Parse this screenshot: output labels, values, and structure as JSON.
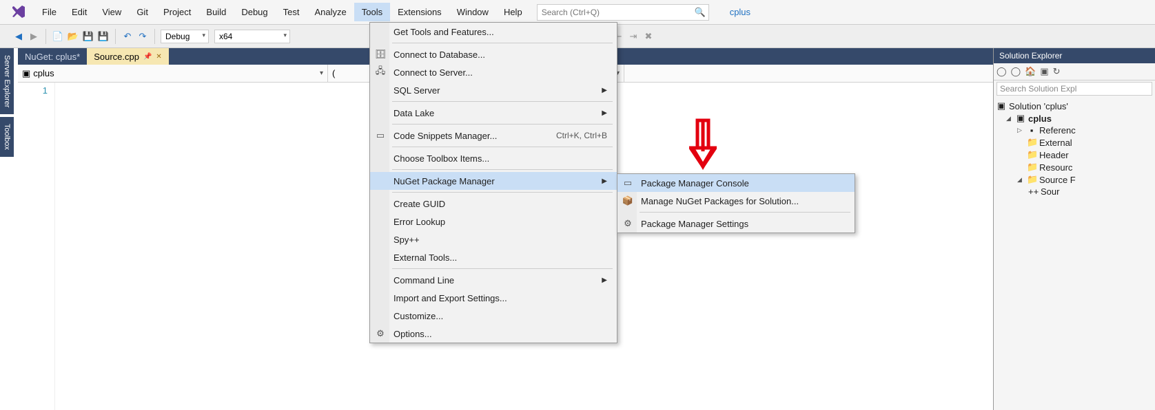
{
  "menubar": {
    "items": [
      "File",
      "Edit",
      "View",
      "Git",
      "Project",
      "Build",
      "Debug",
      "Test",
      "Analyze",
      "Tools",
      "Extensions",
      "Window",
      "Help"
    ],
    "activeIndex": 9,
    "search_placeholder": "Search (Ctrl+Q)",
    "solution_name": "cplus"
  },
  "toolbar": {
    "config": "Debug",
    "platform": "x64"
  },
  "side_tabs": [
    "Server Explorer",
    "Toolbox"
  ],
  "doc_tabs": [
    {
      "label": "NuGet: cplus*",
      "active": false
    },
    {
      "label": "Source.cpp",
      "active": true
    }
  ],
  "combo_row": {
    "left": "cplus",
    "mid": "(",
    "right": ""
  },
  "editor": {
    "line1": "1"
  },
  "tools_menu": {
    "items": [
      {
        "label": "Get Tools and Features..."
      },
      {
        "sep": true
      },
      {
        "label": "Connect to Database...",
        "icon": "db"
      },
      {
        "label": "Connect to Server...",
        "icon": "srv"
      },
      {
        "label": "SQL Server",
        "sub": true
      },
      {
        "sep": true
      },
      {
        "label": "Data Lake",
        "sub": true
      },
      {
        "sep": true
      },
      {
        "label": "Code Snippets Manager...",
        "icon": "snip",
        "shortcut": "Ctrl+K, Ctrl+B"
      },
      {
        "sep": true
      },
      {
        "label": "Choose Toolbox Items..."
      },
      {
        "sep": true
      },
      {
        "label": "NuGet Package Manager",
        "sub": true,
        "hl": true
      },
      {
        "sep": true
      },
      {
        "label": "Create GUID"
      },
      {
        "label": "Error Lookup"
      },
      {
        "label": "Spy++"
      },
      {
        "label": "External Tools..."
      },
      {
        "sep": true
      },
      {
        "label": "Command Line",
        "sub": true
      },
      {
        "label": "Import and Export Settings..."
      },
      {
        "label": "Customize..."
      },
      {
        "label": "Options...",
        "icon": "gear"
      }
    ]
  },
  "sub_menu": {
    "items": [
      {
        "label": "Package Manager Console",
        "icon": "console",
        "hl": true
      },
      {
        "label": "Manage NuGet Packages for Solution...",
        "icon": "pkg"
      },
      {
        "sep": true
      },
      {
        "label": "Package Manager Settings",
        "icon": "gear"
      }
    ]
  },
  "solution_explorer": {
    "title": "Solution Explorer",
    "search_placeholder": "Search Solution Expl",
    "nodes": {
      "root": "Solution 'cplus'",
      "proj": "cplus",
      "refs": "Referenc",
      "ext": "External",
      "hdr": "Header",
      "res": "Resourc",
      "src": "Source F",
      "srcfile": "Sour"
    }
  }
}
